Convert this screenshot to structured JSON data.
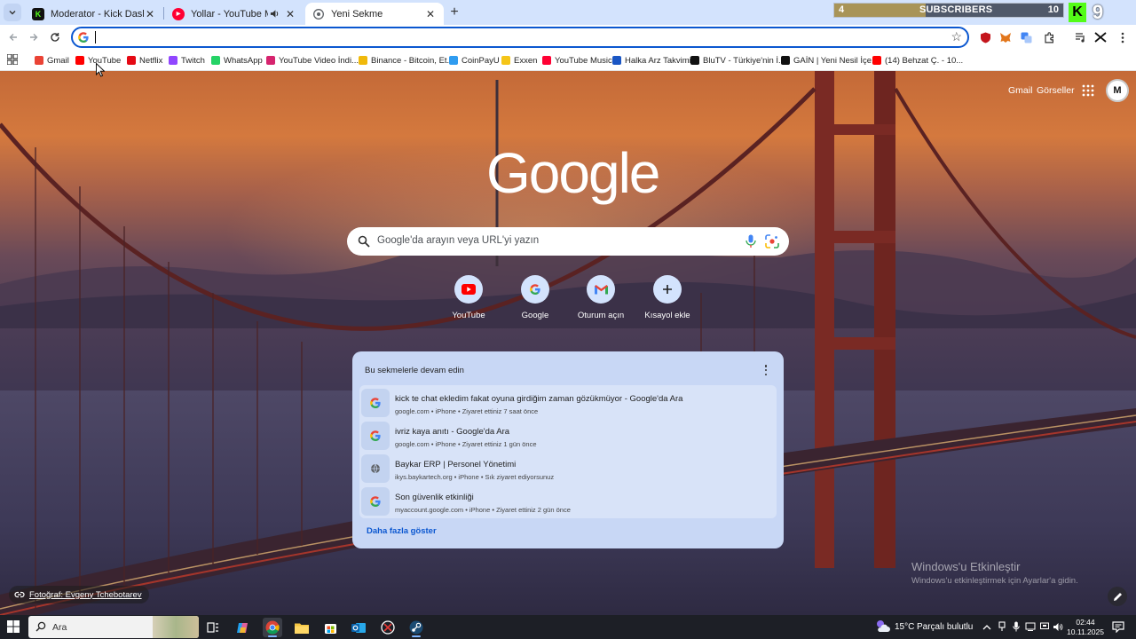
{
  "tabs": [
    {
      "title": "Moderator - Kick Dashboard",
      "favicon": "kick-icon",
      "color": "#53fc18",
      "active": false
    },
    {
      "title": "Yollar - YouTube Music",
      "favicon": "youtube-music-icon",
      "color": "#ff0033",
      "active": false,
      "audio": true
    },
    {
      "title": "Yeni Sekme",
      "favicon": "chrome-newtab-icon",
      "color": "#5f6368",
      "active": true
    }
  ],
  "subscriber_widget": {
    "left_value": "4",
    "label": "SUBSCRIBERS",
    "right_value": "10",
    "progress_fraction": 0.4,
    "big_count": "9",
    "badge_letter": "K"
  },
  "omnibox": {
    "value": "",
    "placeholder": ""
  },
  "bookmarks": [
    {
      "label": "Gmail",
      "icon": "gmail-icon",
      "color": "#ea4335"
    },
    {
      "label": "YouTube",
      "icon": "youtube-icon",
      "color": "#ff0000"
    },
    {
      "label": "Netflix",
      "icon": "netflix-icon",
      "color": "#e50914"
    },
    {
      "label": "Twitch",
      "icon": "twitch-icon",
      "color": "#9146ff"
    },
    {
      "label": "WhatsApp",
      "icon": "whatsapp-icon",
      "color": "#25d366"
    },
    {
      "label": "YouTube Video İndi...",
      "icon": "download-icon",
      "color": "#d6246e"
    },
    {
      "label": "Binance - Bitcoin, Et...",
      "icon": "binance-icon",
      "color": "#f0b90b"
    },
    {
      "label": "CoinPayU",
      "icon": "coinpayu-icon",
      "color": "#2f9cf0"
    },
    {
      "label": "Exxen",
      "icon": "exxen-icon",
      "color": "#f5c518"
    },
    {
      "label": "YouTube Music",
      "icon": "youtube-music-icon",
      "color": "#ff0033"
    },
    {
      "label": "Halka Arz Takvimi",
      "icon": "halka-arz-icon",
      "color": "#1a56c4"
    },
    {
      "label": "BluTV - Türkiye'nin İ...",
      "icon": "blutv-icon",
      "color": "#111111"
    },
    {
      "label": "GAİN | Yeni Nesil İçe...",
      "icon": "gain-icon",
      "color": "#111111"
    },
    {
      "label": "(14) Behzat Ç. - 10...",
      "icon": "youtube-icon",
      "color": "#ff0000"
    }
  ],
  "newtab": {
    "top_links": {
      "gmail": "Gmail",
      "images": "Görseller"
    },
    "avatar_initials": "M",
    "logo_text": "Google",
    "search_placeholder": "Google'da arayın veya URL'yi yazın",
    "shortcuts": [
      {
        "label": "YouTube",
        "icon": "youtube-icon"
      },
      {
        "label": "Google",
        "icon": "google-g-icon"
      },
      {
        "label": "Oturum açın",
        "icon": "gmail-icon"
      },
      {
        "label": "Kısayol ekle",
        "icon": "plus-icon"
      }
    ],
    "continue_card": {
      "heading": "Bu sekmelerle devam edin",
      "items": [
        {
          "title": "kick te chat ekledim fakat oyuna girdiğim zaman gözükmüyor - Google'da Ara",
          "subtitle": "google.com • iPhone • Ziyaret ettiniz 7 saat önce",
          "icon": "google-g-icon"
        },
        {
          "title": "ivriz kaya anıtı - Google'da Ara",
          "subtitle": "google.com • iPhone • Ziyaret ettiniz 1 gün önce",
          "icon": "google-g-icon"
        },
        {
          "title": "Baykar ERP | Personel Yönetimi",
          "subtitle": "ikys.baykartech.org • iPhone • Sık ziyaret ediyorsunuz",
          "icon": "globe-icon"
        },
        {
          "title": "Son güvenlik etkinliği",
          "subtitle": "myaccount.google.com • iPhone • Ziyaret ettiniz 2 gün önce",
          "icon": "google-g-icon"
        }
      ],
      "show_more": "Daha fazla göster"
    },
    "photo_credit": "Fotoğraf: Evgeny Tchebotarev",
    "activation_title": "Windows'u Etkinleştir",
    "activation_sub": "Windows'u etkinleştirmek için Ayarlar'a gidin."
  },
  "taskbar": {
    "search_placeholder": "Ara",
    "weather_temp": "15°C",
    "weather_desc": "Parçalı bulutlu",
    "time": "02:44",
    "date": "10.11.2025"
  }
}
